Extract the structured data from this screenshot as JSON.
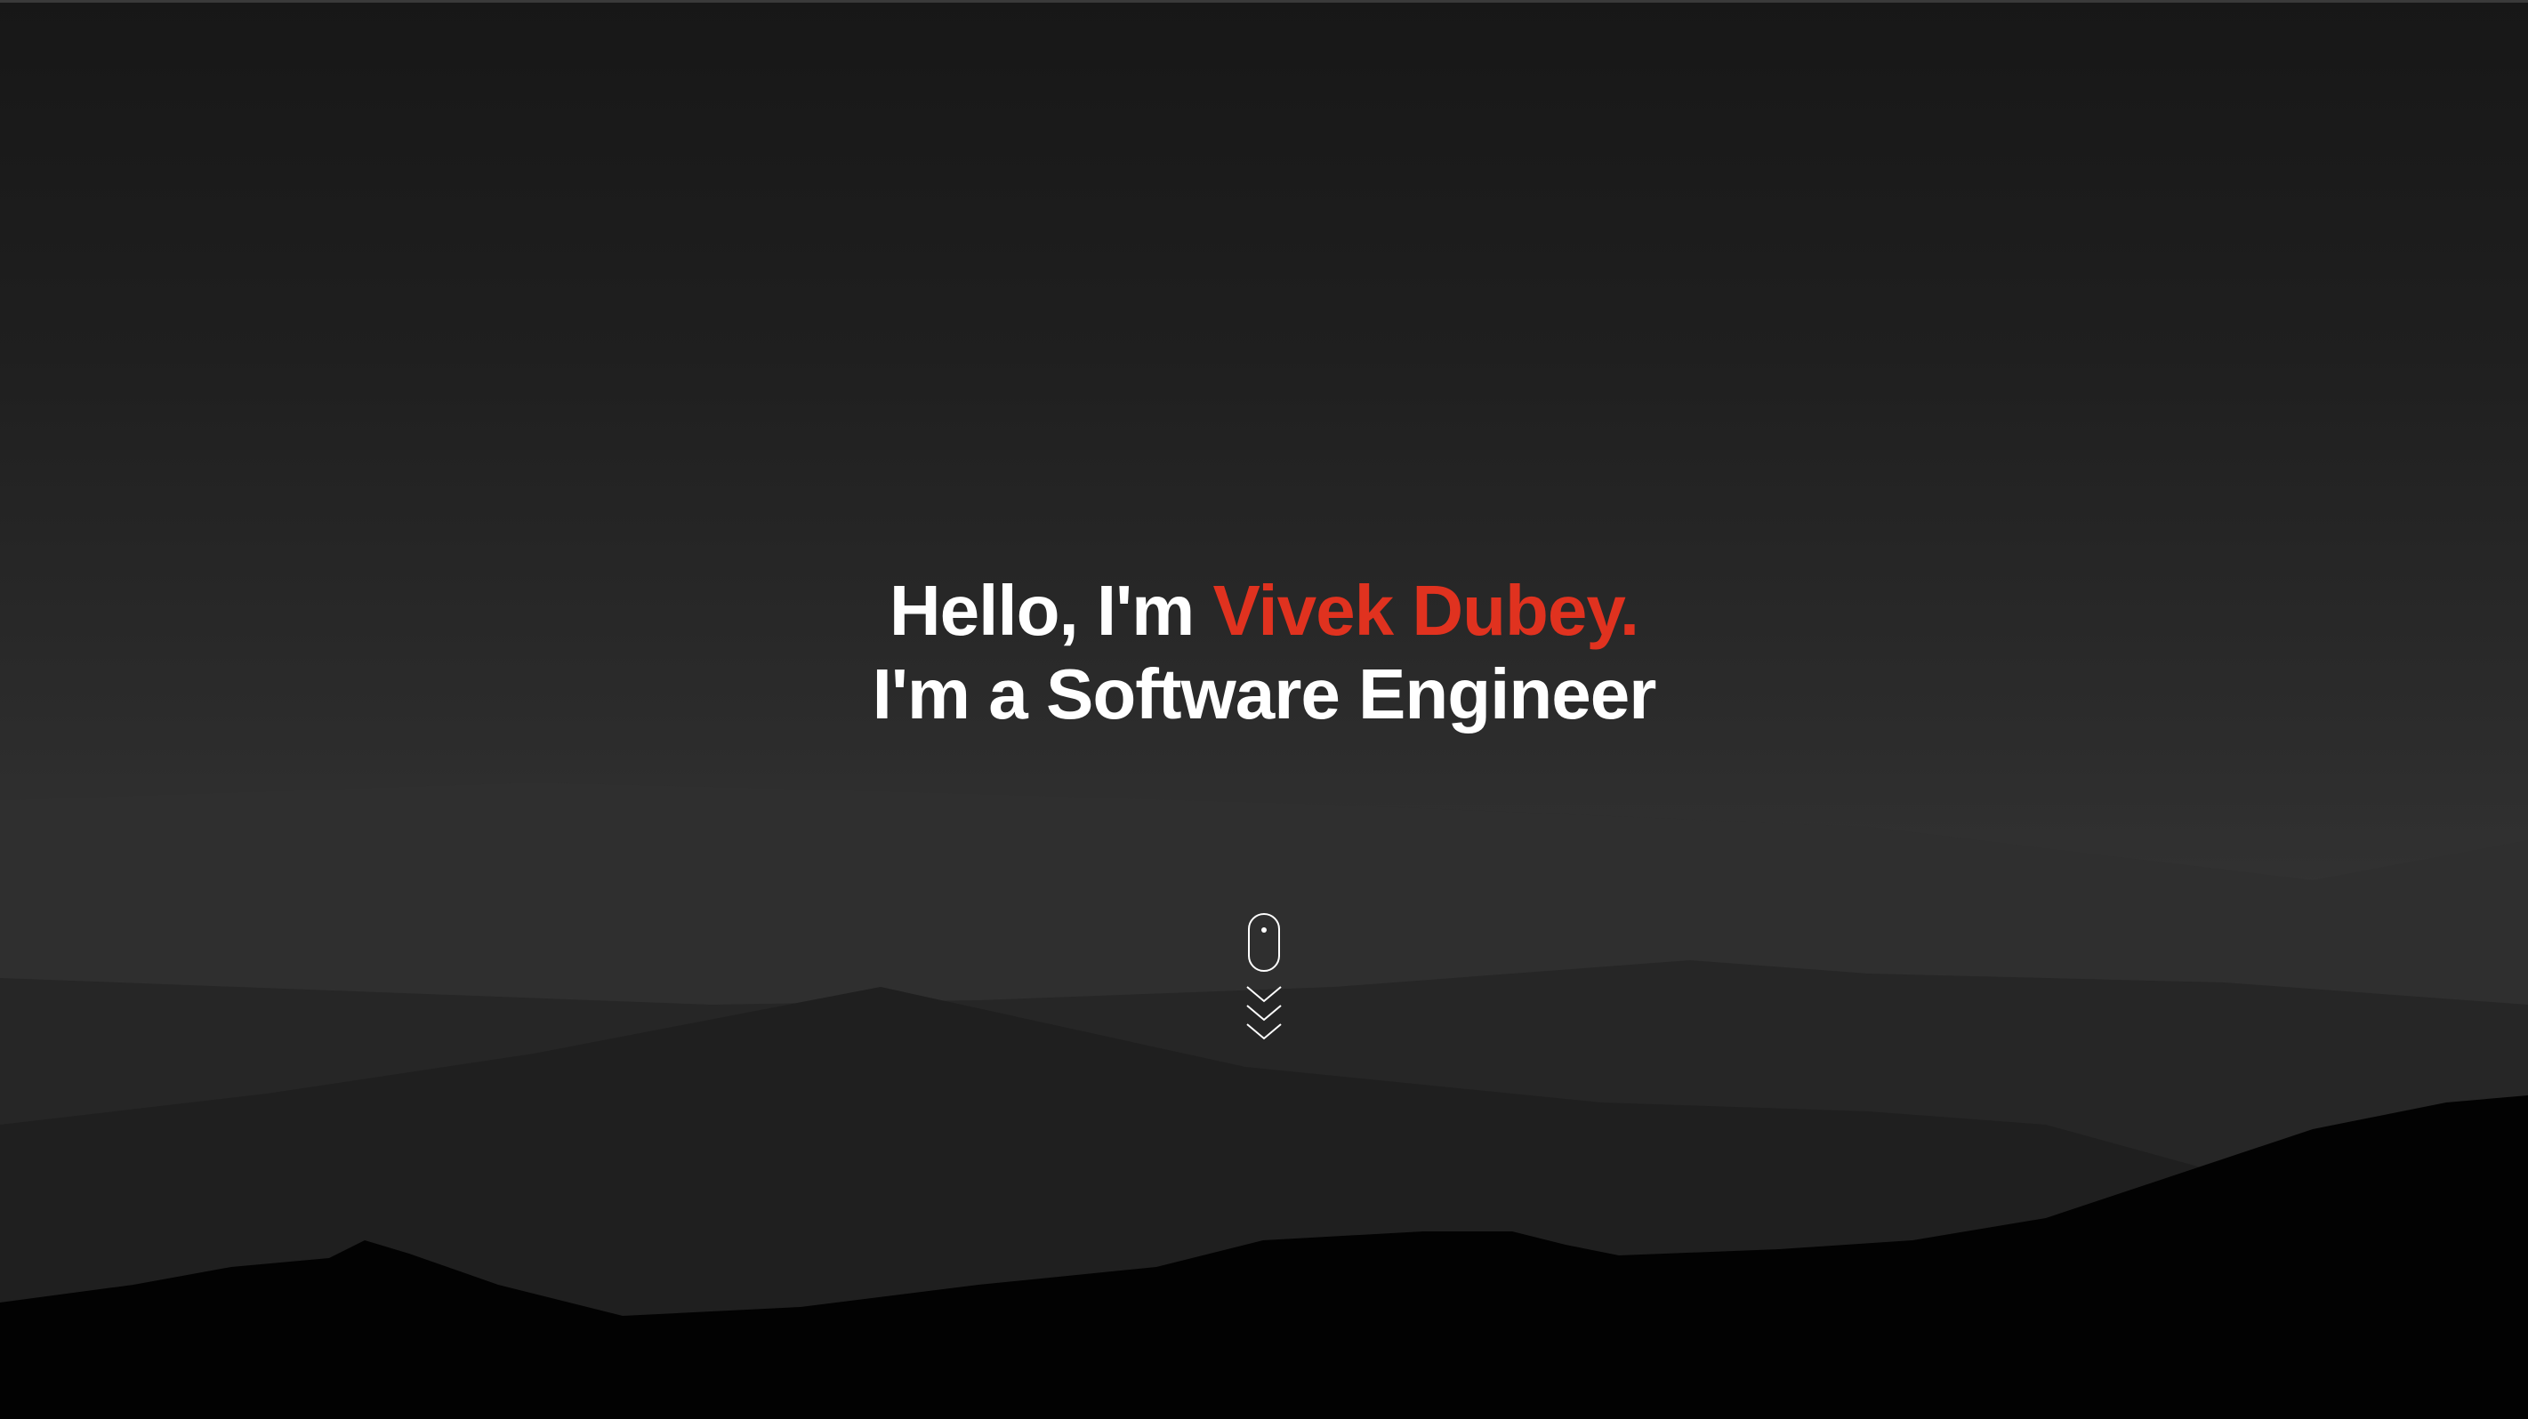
{
  "hero": {
    "greeting_prefix": "Hello, I'm ",
    "name": "Vivek Dubey.",
    "tagline": "I'm a Software Engineer"
  },
  "colors": {
    "accent": "#e0321f",
    "text": "#ffffff",
    "background": "#1f1f1f"
  },
  "scroll_indicator": {
    "icon": "mouse-scroll-icon",
    "chevrons": 3
  }
}
